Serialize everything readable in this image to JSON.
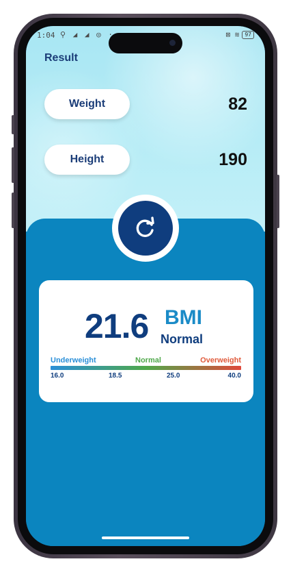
{
  "status_bar": {
    "time": "1:04",
    "left_icons": "⚲ ◢ ◢ ◎ ···",
    "right_icons": "⊠ ≋",
    "battery": "97"
  },
  "header": {
    "title": "Result"
  },
  "inputs": {
    "weight": {
      "label": "Weight",
      "value": "82"
    },
    "height": {
      "label": "Height",
      "value": "190"
    }
  },
  "refresh_button": {
    "icon": "refresh-icon"
  },
  "result": {
    "bmi_value": "21.6",
    "bmi_label": "BMI",
    "category": "Normal",
    "scale": {
      "categories": [
        "Underweight",
        "Normal",
        "Overweight"
      ],
      "ticks": [
        "16.0",
        "18.5",
        "25.0",
        "40.0"
      ]
    }
  },
  "colors": {
    "brand_dark": "#0f3d7e",
    "panel_blue": "#0b85bf",
    "accent_blue": "#1b8bc7",
    "underweight": "#2a8fd8",
    "normal": "#4fa84a",
    "overweight": "#e05a3b"
  }
}
